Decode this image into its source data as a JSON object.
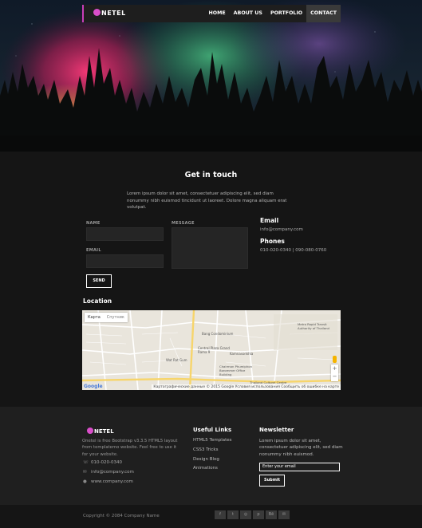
{
  "nav": {
    "logo_text": "NETEL",
    "items": [
      "HOME",
      "ABOUT US",
      "PORTFOLIO",
      "CONTACT"
    ],
    "active": "CONTACT",
    "accent": "#c73eb7"
  },
  "contact": {
    "title": "Get in touch",
    "lead": "Lorem ipsum dolor sit amet, consectetuer adipiscing elit, sed diam nonummy nibh euismod tincidunt ut laoreet. Dolore magna aliquam erat volutpat.",
    "name_label": "NAME",
    "email_label": "EMAIL",
    "message_label": "MESSAGE",
    "send_label": "SEND",
    "email_heading": "Email",
    "email_value": "info@company.com",
    "phones_heading": "Phones",
    "phones_value": "010-020-0340 | 090-080-0760"
  },
  "location": {
    "title": "Location",
    "tab_map": "Карта",
    "tab_sat": "Спутник",
    "google": "Google",
    "attribution": "Картографические данные © 2015 Google   Условия использования   Сообщить об ошибке на карте",
    "places": [
      "Bang Condominium",
      "Central Plaza Grand Rama 9",
      "Wat Rat Gum",
      "Kamnasonkhla",
      "Chairman Phumiphon Borommer Office Building",
      "Thailand Cultural Centre",
      "Metro Rapid Transit Authority of Thailand"
    ]
  },
  "footer": {
    "logo_text": "NETEL",
    "description": "Onetel is free Bootstrap v3.3.5 HTML5 layout from templatemo website. Feel free to use it for your website.",
    "phone": "010-020-0340",
    "email": "info@company.com",
    "website": "www.company.com",
    "links_heading": "Useful Links",
    "links": [
      "HTML5 Templates",
      "CSS3 Tricks",
      "Design Blog",
      "Animations"
    ],
    "newsletter_heading": "Newsletter",
    "newsletter_text": "Lorem ipsum dolor sit amet, consectetuer adipiscing elit, sed diam nonummy nibh euismod.",
    "newsletter_placeholder": "Enter your email",
    "submit_label": "Submit",
    "copyright": "Copyright © 2084 Company Name",
    "social_icons": [
      "facebook-icon",
      "twitter-icon",
      "dribbble-icon",
      "pinterest-icon",
      "behance-icon",
      "envelope-icon"
    ],
    "social_glyphs": [
      "f",
      "t",
      "◎",
      "p",
      "Bē",
      "✉"
    ]
  }
}
